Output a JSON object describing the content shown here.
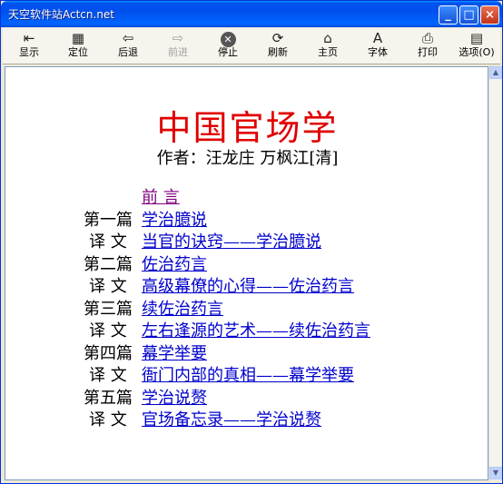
{
  "window": {
    "title": "天空软件站Actcn.net"
  },
  "toolbar": {
    "buttons": [
      {
        "label": "显示",
        "icon": "show-icon"
      },
      {
        "label": "定位",
        "icon": "locate-icon"
      },
      {
        "label": "后退",
        "icon": "back-arrow-icon"
      },
      {
        "label": "前进",
        "icon": "forward-arrow-icon",
        "disabled": true
      },
      {
        "label": "停止",
        "icon": "stop-icon"
      },
      {
        "label": "刷新",
        "icon": "refresh-icon"
      },
      {
        "label": "主页",
        "icon": "home-icon"
      },
      {
        "label": "字体",
        "icon": "font-icon"
      },
      {
        "label": "打印",
        "icon": "print-icon"
      },
      {
        "label": "选项(O)",
        "icon": "options-icon"
      }
    ]
  },
  "content": {
    "title": "中国官场学",
    "author": "作者：汪龙庄  万枫江[清]",
    "toc": [
      {
        "prefix": "",
        "link": "前  言",
        "visited": true
      },
      {
        "prefix": "第一篇",
        "link": "学治臆说"
      },
      {
        "prefix": "译  文",
        "link": "当官的诀窍——学治臆说"
      },
      {
        "prefix": "第二篇",
        "link": "佐治药言"
      },
      {
        "prefix": "译  文",
        "link": "高级幕僚的心得——佐治药言"
      },
      {
        "prefix": "第三篇",
        "link": "续佐治药言"
      },
      {
        "prefix": "译  文",
        "link": "左右逢源的艺术——续佐治药言"
      },
      {
        "prefix": "第四篇",
        "link": "幕学举要"
      },
      {
        "prefix": "译  文",
        "link": "衙门内部的真相——幕学举要"
      },
      {
        "prefix": "第五篇",
        "link": "学治说赘"
      },
      {
        "prefix": "译  文",
        "link": "官场备忘录——学治说赘"
      }
    ]
  },
  "colors": {
    "title_red": "#e00000",
    "link_blue": "#0000cc",
    "link_visited": "#800080",
    "titlebar_blue": "#0053ee"
  }
}
